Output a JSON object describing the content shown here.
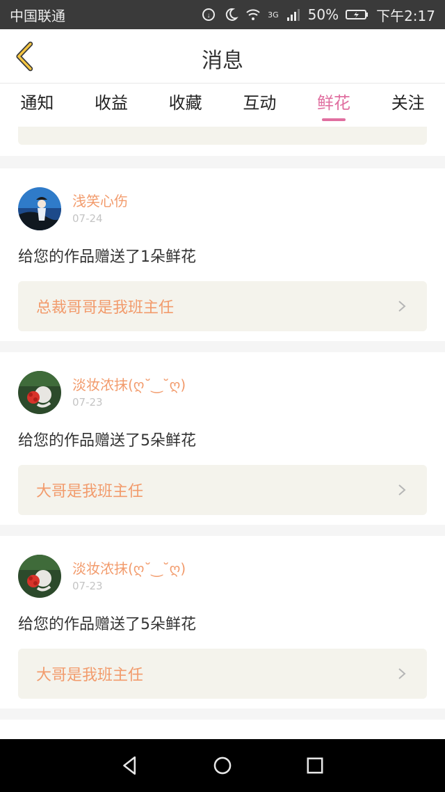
{
  "status_bar": {
    "carrier": "中国联通",
    "network": "3G",
    "battery": "50%",
    "time": "下午2:17"
  },
  "header": {
    "title": "消息"
  },
  "tabs": [
    {
      "label": "通知",
      "active": false
    },
    {
      "label": "收益",
      "active": false
    },
    {
      "label": "收藏",
      "active": false
    },
    {
      "label": "互动",
      "active": false
    },
    {
      "label": "鲜花",
      "active": true
    },
    {
      "label": "关注",
      "active": false
    }
  ],
  "cards": [
    {
      "username": "浅笑心伤",
      "date": "07-24",
      "message": "给您的作品赠送了1朵鲜花",
      "work_title": "总裁哥哥是我班主任"
    },
    {
      "username": "淡妆浓抹(ღ˘‿˘ღ)",
      "date": "07-23",
      "message": "给您的作品赠送了5朵鲜花",
      "work_title": "大哥是我班主任"
    },
    {
      "username": "淡妆浓抹(ღ˘‿˘ღ)",
      "date": "07-23",
      "message": "给您的作品赠送了5朵鲜花",
      "work_title": "大哥是我班主任"
    }
  ],
  "colors": {
    "accent_pink": "#e06fa0",
    "username_orange": "#f29b6c",
    "work_bg": "#f4f3ec"
  }
}
